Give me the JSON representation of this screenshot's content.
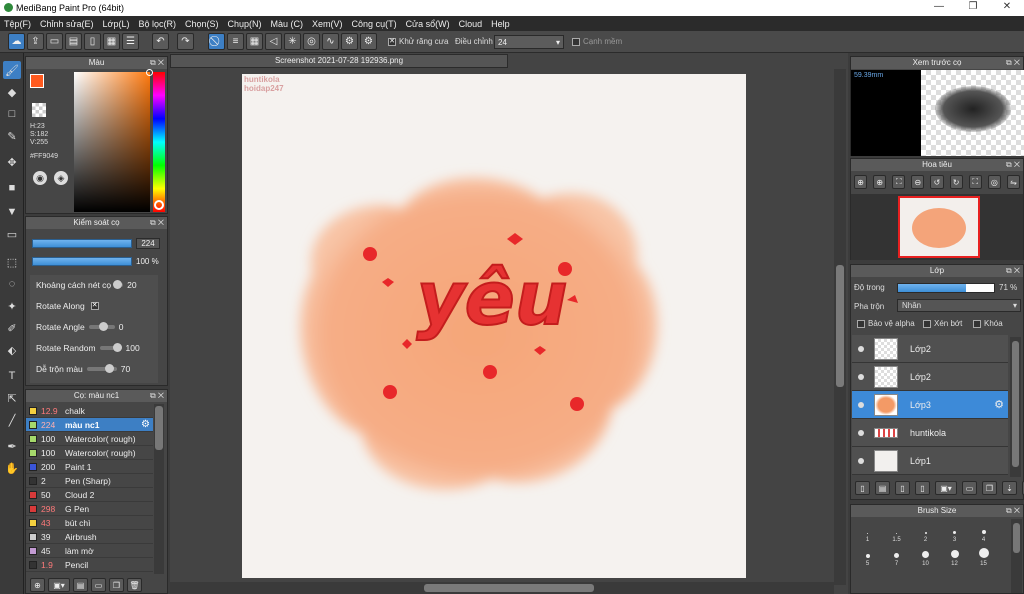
{
  "window": {
    "title": "MediBang Paint Pro (64bit)",
    "minimize": "—",
    "restore": "❐",
    "close": "✕"
  },
  "menu": [
    "Tệp(F)",
    "Chỉnh sửa(E)",
    "Lớp(L)",
    "Bộ lọc(R)",
    "Chọn(S)",
    "Chụp(N)",
    "Màu (C)",
    "Xem(V)",
    "Công cụ(T)",
    "Cửa sổ(W)",
    "Cloud",
    "Help"
  ],
  "toolbar": {
    "antialias_label": "Khử răng cưa",
    "adjust_label": "Điều chỉnh",
    "adjust_value": "24",
    "edge_label": "Cạnh mềm"
  },
  "color_panel": {
    "title": "Màu",
    "h": "H:23",
    "s": "S:182",
    "v": "V:255",
    "hex": "#FF9049",
    "fg": "#ff5a1f",
    "bg": "#ffffff"
  },
  "brush_control": {
    "title": "Kiểm soát cọ",
    "size_value": "224",
    "opacity_value": "100 %",
    "rows": [
      {
        "label": "Khoảng cách nét cọ",
        "value": "20",
        "pos": 0.2
      },
      {
        "label": "Rotate Along",
        "value": "",
        "pos": null
      },
      {
        "label": "Rotate Angle",
        "value": "0",
        "pos": 0.5
      },
      {
        "label": "Rotate Random",
        "value": "100",
        "pos": 1.0
      },
      {
        "label": "Dễ trộn màu",
        "value": "70",
        "pos": 0.7
      }
    ]
  },
  "brush_list": {
    "title": "Cọ: màu nc1",
    "items": [
      {
        "size": "12.9",
        "name": "chalk",
        "color": "#f4d03f",
        "size_red": true,
        "sel": false
      },
      {
        "size": "224",
        "name": "màu nc1",
        "color": "#a5d86b",
        "size_red": true,
        "sel": true
      },
      {
        "size": "100",
        "name": "Watercolor( rough)",
        "color": "#a5d86b",
        "size_red": false,
        "sel": false
      },
      {
        "size": "100",
        "name": "Watercolor( rough)",
        "color": "#a5d86b",
        "size_red": false,
        "sel": false
      },
      {
        "size": "200",
        "name": "Paint 1",
        "color": "#3a55d8",
        "size_red": false,
        "sel": false
      },
      {
        "size": "2",
        "name": "Pen (Sharp)",
        "color": "#333333",
        "size_red": false,
        "sel": false
      },
      {
        "size": "50",
        "name": "Cloud 2",
        "color": "#d83a3a",
        "size_red": false,
        "sel": false
      },
      {
        "size": "298",
        "name": "G Pen",
        "color": "#d83a3a",
        "size_red": true,
        "sel": false
      },
      {
        "size": "43",
        "name": "bút chì",
        "color": "#f4d03f",
        "size_red": true,
        "sel": false
      },
      {
        "size": "39",
        "name": "Airbrush",
        "color": "#cccccc",
        "size_red": false,
        "sel": false
      },
      {
        "size": "45",
        "name": "làm mờ",
        "color": "#c39bd3",
        "size_red": false,
        "sel": false
      },
      {
        "size": "1.9",
        "name": "Pencil",
        "color": "#333333",
        "size_red": true,
        "sel": false
      }
    ]
  },
  "canvas": {
    "tab": "Screenshot 2021-07-28 192936.png",
    "watermark1": "huntikola",
    "watermark2": "hoidap247",
    "art_text": "yêu"
  },
  "preview": {
    "title": "Xem trước cọ",
    "size": "59.39mm"
  },
  "navigator": {
    "title": "Hoa tiêu"
  },
  "layers": {
    "title": "Lớp",
    "opacity_label": "Độ trong",
    "opacity_value": "71 %",
    "opacity": 0.71,
    "blend_label": "Pha trộn",
    "blend_value": "Nhân",
    "protect_alpha": "Bảo vệ alpha",
    "clipping": "Xén bớt",
    "lock": "Khóa",
    "items": [
      {
        "name": "Lớp2",
        "sel": false
      },
      {
        "name": "Lớp2",
        "sel": false
      },
      {
        "name": "Lớp3",
        "sel": true
      },
      {
        "name": "huntikola",
        "sel": false
      },
      {
        "name": "Lớp1",
        "sel": false
      }
    ]
  },
  "brush_size": {
    "title": "Brush Size",
    "labels": [
      "1",
      "1.5",
      "2",
      "3",
      "4",
      "5",
      "7",
      "10",
      "12",
      "15"
    ]
  }
}
